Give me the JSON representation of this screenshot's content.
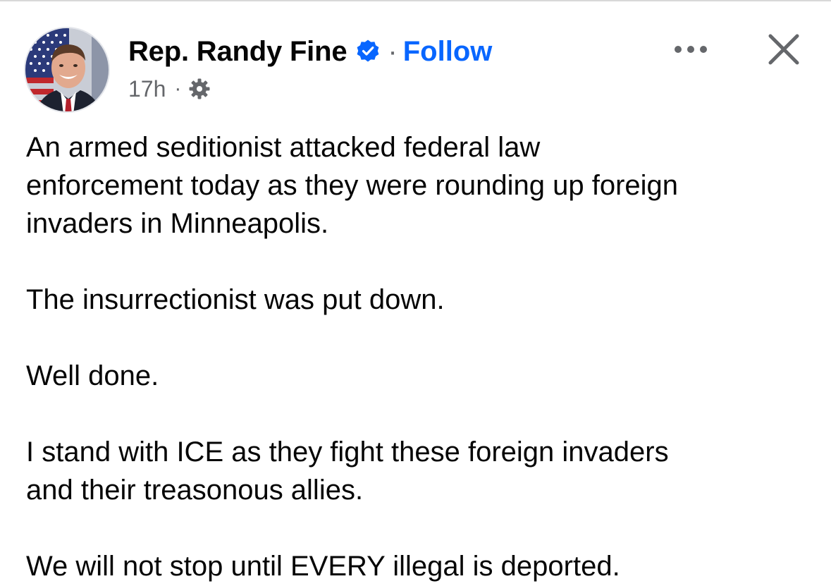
{
  "post": {
    "author": "Rep. Randy Fine",
    "follow_label": "Follow",
    "separator": "·",
    "timestamp": "17h",
    "meta_separator": "·",
    "icons": {
      "avatar": "profile-photo",
      "verified": "verified-badge-icon",
      "audience": "gear-icon",
      "more": "more-options-icon",
      "close": "close-icon"
    },
    "paragraphs": [
      "An armed seditionist attacked federal law\nenforcement today as they were rounding up foreign\ninvaders in Minneapolis.",
      "The insurrectionist was put down.",
      "Well done.",
      "I stand with ICE as they fight these foreign invaders\nand their treasonous allies.",
      "We will not stop until EVERY illegal is deported."
    ]
  },
  "colors": {
    "text": "#050505",
    "secondary": "#65676b",
    "link": "#0866ff",
    "verified": "#0866ff"
  }
}
